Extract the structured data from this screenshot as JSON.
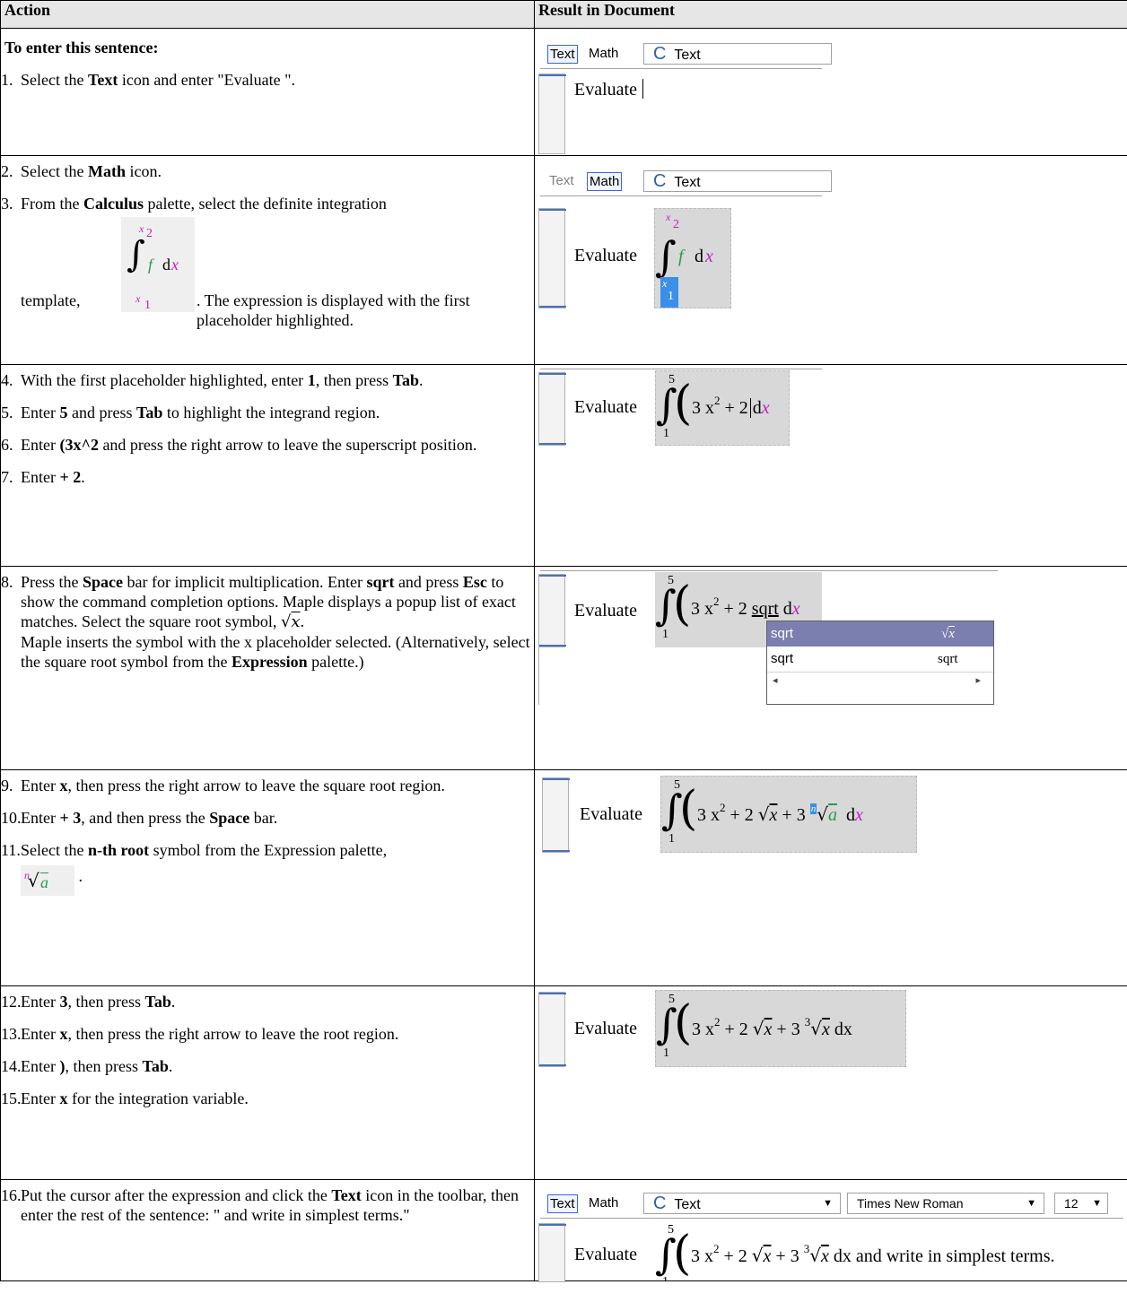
{
  "headers": {
    "action": "Action",
    "result": "Result in Document"
  },
  "row1": {
    "title": "To enter this sentence:",
    "step1": {
      "num": "1.",
      "pre": "Select the ",
      "b1": "Text",
      "post": " icon and enter \"Evaluate \"."
    },
    "toolbar": {
      "text": "Text",
      "math": "Math",
      "style_glyph": "C",
      "style": "Text"
    },
    "doc": "Evaluate"
  },
  "row2": {
    "step2": {
      "num": "2.",
      "pre": "Select the ",
      "b1": "Math",
      "post": " icon."
    },
    "step3": {
      "num": "3.",
      "pre": "From the ",
      "b1": "Calculus",
      "mid": " palette, select the definite integration",
      "t1": "template,",
      "t2": ". The expression is displayed with the first placeholder highlighted."
    },
    "tpl": {
      "ub": "x",
      "ubs": "2",
      "f": "f",
      "d": "d",
      "x": "x",
      "lb": "x",
      "lbs": "1"
    },
    "toolbar": {
      "text": "Text",
      "math": "Math",
      "style_glyph": "C",
      "style": "Text"
    },
    "doc": "Evaluate"
  },
  "row3": {
    "step4": {
      "num": "4.",
      "pre": "With the first placeholder highlighted, enter ",
      "b1": "1",
      "mid": ", then press ",
      "b2": "Tab",
      "post": "."
    },
    "step5": {
      "num": "5.",
      "pre": "Enter ",
      "b1": "5",
      "mid": " and press ",
      "b2": "Tab",
      "post": " to highlight the integrand region."
    },
    "step6": {
      "num": "6.",
      "pre": "Enter ",
      "b1": "(3x^2",
      "post": " and press the right arrow to leave the superscript position."
    },
    "step7": {
      "num": "7.",
      "pre": "Enter ",
      "b1": "+ 2",
      "post": "."
    },
    "doc": "Evaluate",
    "upper": "5",
    "lower": "1",
    "expr": "3 x",
    "pow": "2",
    "rest": " + 2",
    "dx": "d",
    "dxv": "x"
  },
  "row4": {
    "step8": {
      "num": "8.",
      "pre": "Press the ",
      "b1": "Space",
      "mid1": " bar for implicit multiplication. Enter ",
      "b2": "sqrt",
      "mid2": " and press ",
      "b3": "Esc",
      "mid3": " to show the command completion options. Maple displays a popup list of exact matches. Select the square root symbol, ",
      "sym": "x",
      "mid4": ".",
      "line2": "Maple inserts the symbol with the x placeholder selected. (Alternatively, select the square root symbol from the ",
      "b4": "Expression",
      "post": " palette.)"
    },
    "doc": "Evaluate",
    "upper": "5",
    "lower": "1",
    "expr": "3 x",
    "pow": "2",
    "rest": " + 2 ",
    "sqrt": "sqrt",
    "dx": "d",
    "dxv": "x",
    "popup": {
      "r1": "sqrt",
      "r2": "sqrt",
      "r2v": "sqrt",
      "r1v": "x",
      "left": "◂",
      "right": "▸"
    }
  },
  "row5": {
    "step9": {
      "num": "9.",
      "pre": "Enter ",
      "b1": "x",
      "post": ", then press the right arrow to leave the square root region."
    },
    "step10": {
      "num": "10.",
      "pre": "Enter ",
      "b1": "+ 3",
      "mid": ", and then press the ",
      "b2": "Space",
      "post": " bar."
    },
    "step11": {
      "num": "11.",
      "pre": "Select the ",
      "b1": "n-th root",
      "post": " symbol from the Expression palette,",
      "n": "n",
      "a": "a",
      "end": "."
    },
    "doc": "Evaluate",
    "upper": "5",
    "lower": "1",
    "expr": "3 x",
    "pow": "2",
    "rest": " + 2 ",
    "rx": "x",
    "plus3": " + 3 ",
    "idx": "n",
    "a": "a",
    "dx": "d",
    "dxv": "x"
  },
  "row6": {
    "step12": {
      "num": "12.",
      "pre": "Enter ",
      "b1": "3",
      "mid": ", then press ",
      "b2": "Tab",
      "post": "."
    },
    "step13": {
      "num": "13.",
      "pre": "Enter ",
      "b1": "x",
      "post": ", then press the right arrow to leave the root region."
    },
    "step14": {
      "num": "14.",
      "pre": "Enter ",
      "b1": ")",
      "mid": ", then press ",
      "b2": "Tab",
      "post": "."
    },
    "step15": {
      "num": "15.",
      "pre": "Enter ",
      "b1": "x",
      "post": " for the integration variable."
    },
    "doc": "Evaluate",
    "upper": "5",
    "lower": "1",
    "expr": "3 x",
    "pow": "2",
    "rest": " + 2 ",
    "rx": "x",
    "plus3": " + 3 ",
    "idx": "3",
    "rx2": "x",
    "dx": "dx"
  },
  "row7": {
    "step16": {
      "num": "16.",
      "pre": "Put the cursor after the expression and click the ",
      "b1": "Text",
      "post": " icon in the toolbar, then enter the rest of the sentence: \" and write in simplest terms.\""
    },
    "toolbar": {
      "text": "Text",
      "math": "Math",
      "style_glyph": "C",
      "style": "Text",
      "font": "Times New Roman",
      "size": "12",
      "arrow": "▼"
    },
    "doc": "Evaluate",
    "upper": "5",
    "lower": "1",
    "expr": "3 x",
    "pow": "2",
    "rest": " + 2 ",
    "rx": "x",
    "plus3": " + 3 ",
    "idx": "3",
    "rx2": "x",
    "dx": "dx",
    "tail": " and write in simplest terms."
  }
}
